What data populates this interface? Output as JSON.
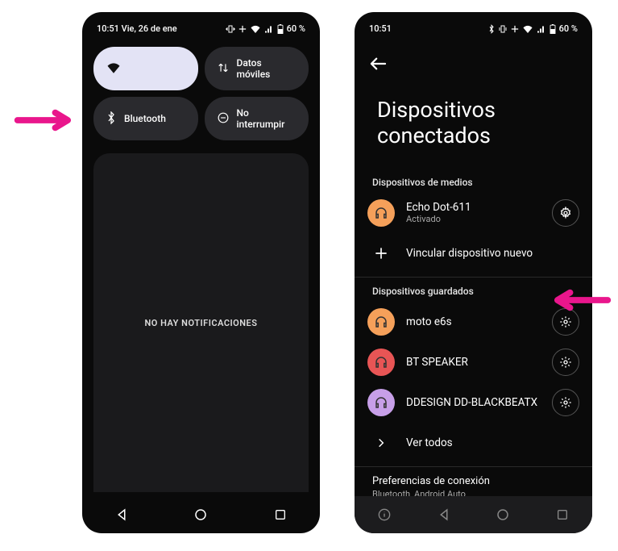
{
  "phone1": {
    "statusbar": {
      "time_date": "10:51  Vie, 26 de ene",
      "battery": "60 %"
    },
    "qs": {
      "wifi": "",
      "data": "Datos móviles",
      "bluetooth": "Bluetooth",
      "dnd": "No interrumpir"
    },
    "no_notifications": "NO HAY NOTIFICACIONES"
  },
  "phone2": {
    "statusbar": {
      "time": "10:51",
      "battery": "60 %"
    },
    "title_line1": "Dispositivos",
    "title_line2": "conectados",
    "section_media": "Dispositivos de medios",
    "media_device": {
      "name": "Echo Dot-611",
      "status": "Activado"
    },
    "pair_new": "Vincular dispositivo nuevo",
    "section_saved": "Dispositivos guardados",
    "saved": [
      {
        "name": "moto e6s",
        "avatar": "orange"
      },
      {
        "name": "BT SPEAKER",
        "avatar": "red"
      },
      {
        "name": "DDESIGN DD-BLACKBEATX",
        "avatar": "lilac"
      }
    ],
    "see_all": "Ver todos",
    "prefs_title": "Preferencias de conexión",
    "prefs_sub": "Bluetooth, Android Auto"
  }
}
